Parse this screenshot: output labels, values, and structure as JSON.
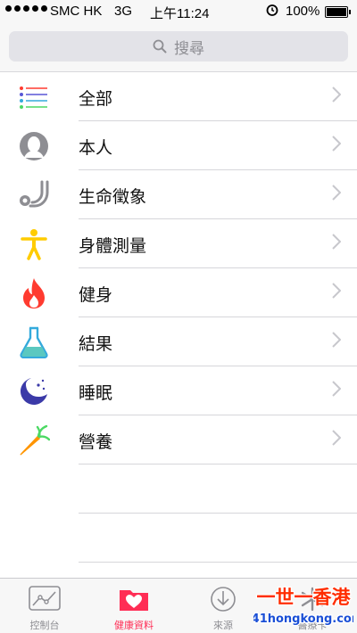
{
  "status_bar": {
    "carrier": "SMC HK",
    "network": "3G",
    "time": "上午11:24",
    "battery": "100%"
  },
  "search": {
    "placeholder": "搜尋"
  },
  "categories": [
    {
      "label": "全部",
      "icon": "list-icon"
    },
    {
      "label": "本人",
      "icon": "person-icon"
    },
    {
      "label": "生命徵象",
      "icon": "stethoscope-icon"
    },
    {
      "label": "身體測量",
      "icon": "body-icon"
    },
    {
      "label": "健身",
      "icon": "flame-icon"
    },
    {
      "label": "結果",
      "icon": "flask-icon"
    },
    {
      "label": "睡眠",
      "icon": "moon-icon"
    },
    {
      "label": "營養",
      "icon": "carrot-icon"
    }
  ],
  "tabs": [
    {
      "label": "控制台",
      "icon": "dashboard-icon",
      "active": false
    },
    {
      "label": "健康資料",
      "icon": "health-data-icon",
      "active": true
    },
    {
      "label": "來源",
      "icon": "sources-icon",
      "active": false
    },
    {
      "label": "醫療卡",
      "icon": "medical-id-icon",
      "active": false
    }
  ],
  "watermark": {
    "text": "一世一香港",
    "url": "141hongkong.com"
  },
  "colors": {
    "accent": "#ff2d55",
    "chevron": "#c7c7cc",
    "separator": "#d6d6da"
  }
}
